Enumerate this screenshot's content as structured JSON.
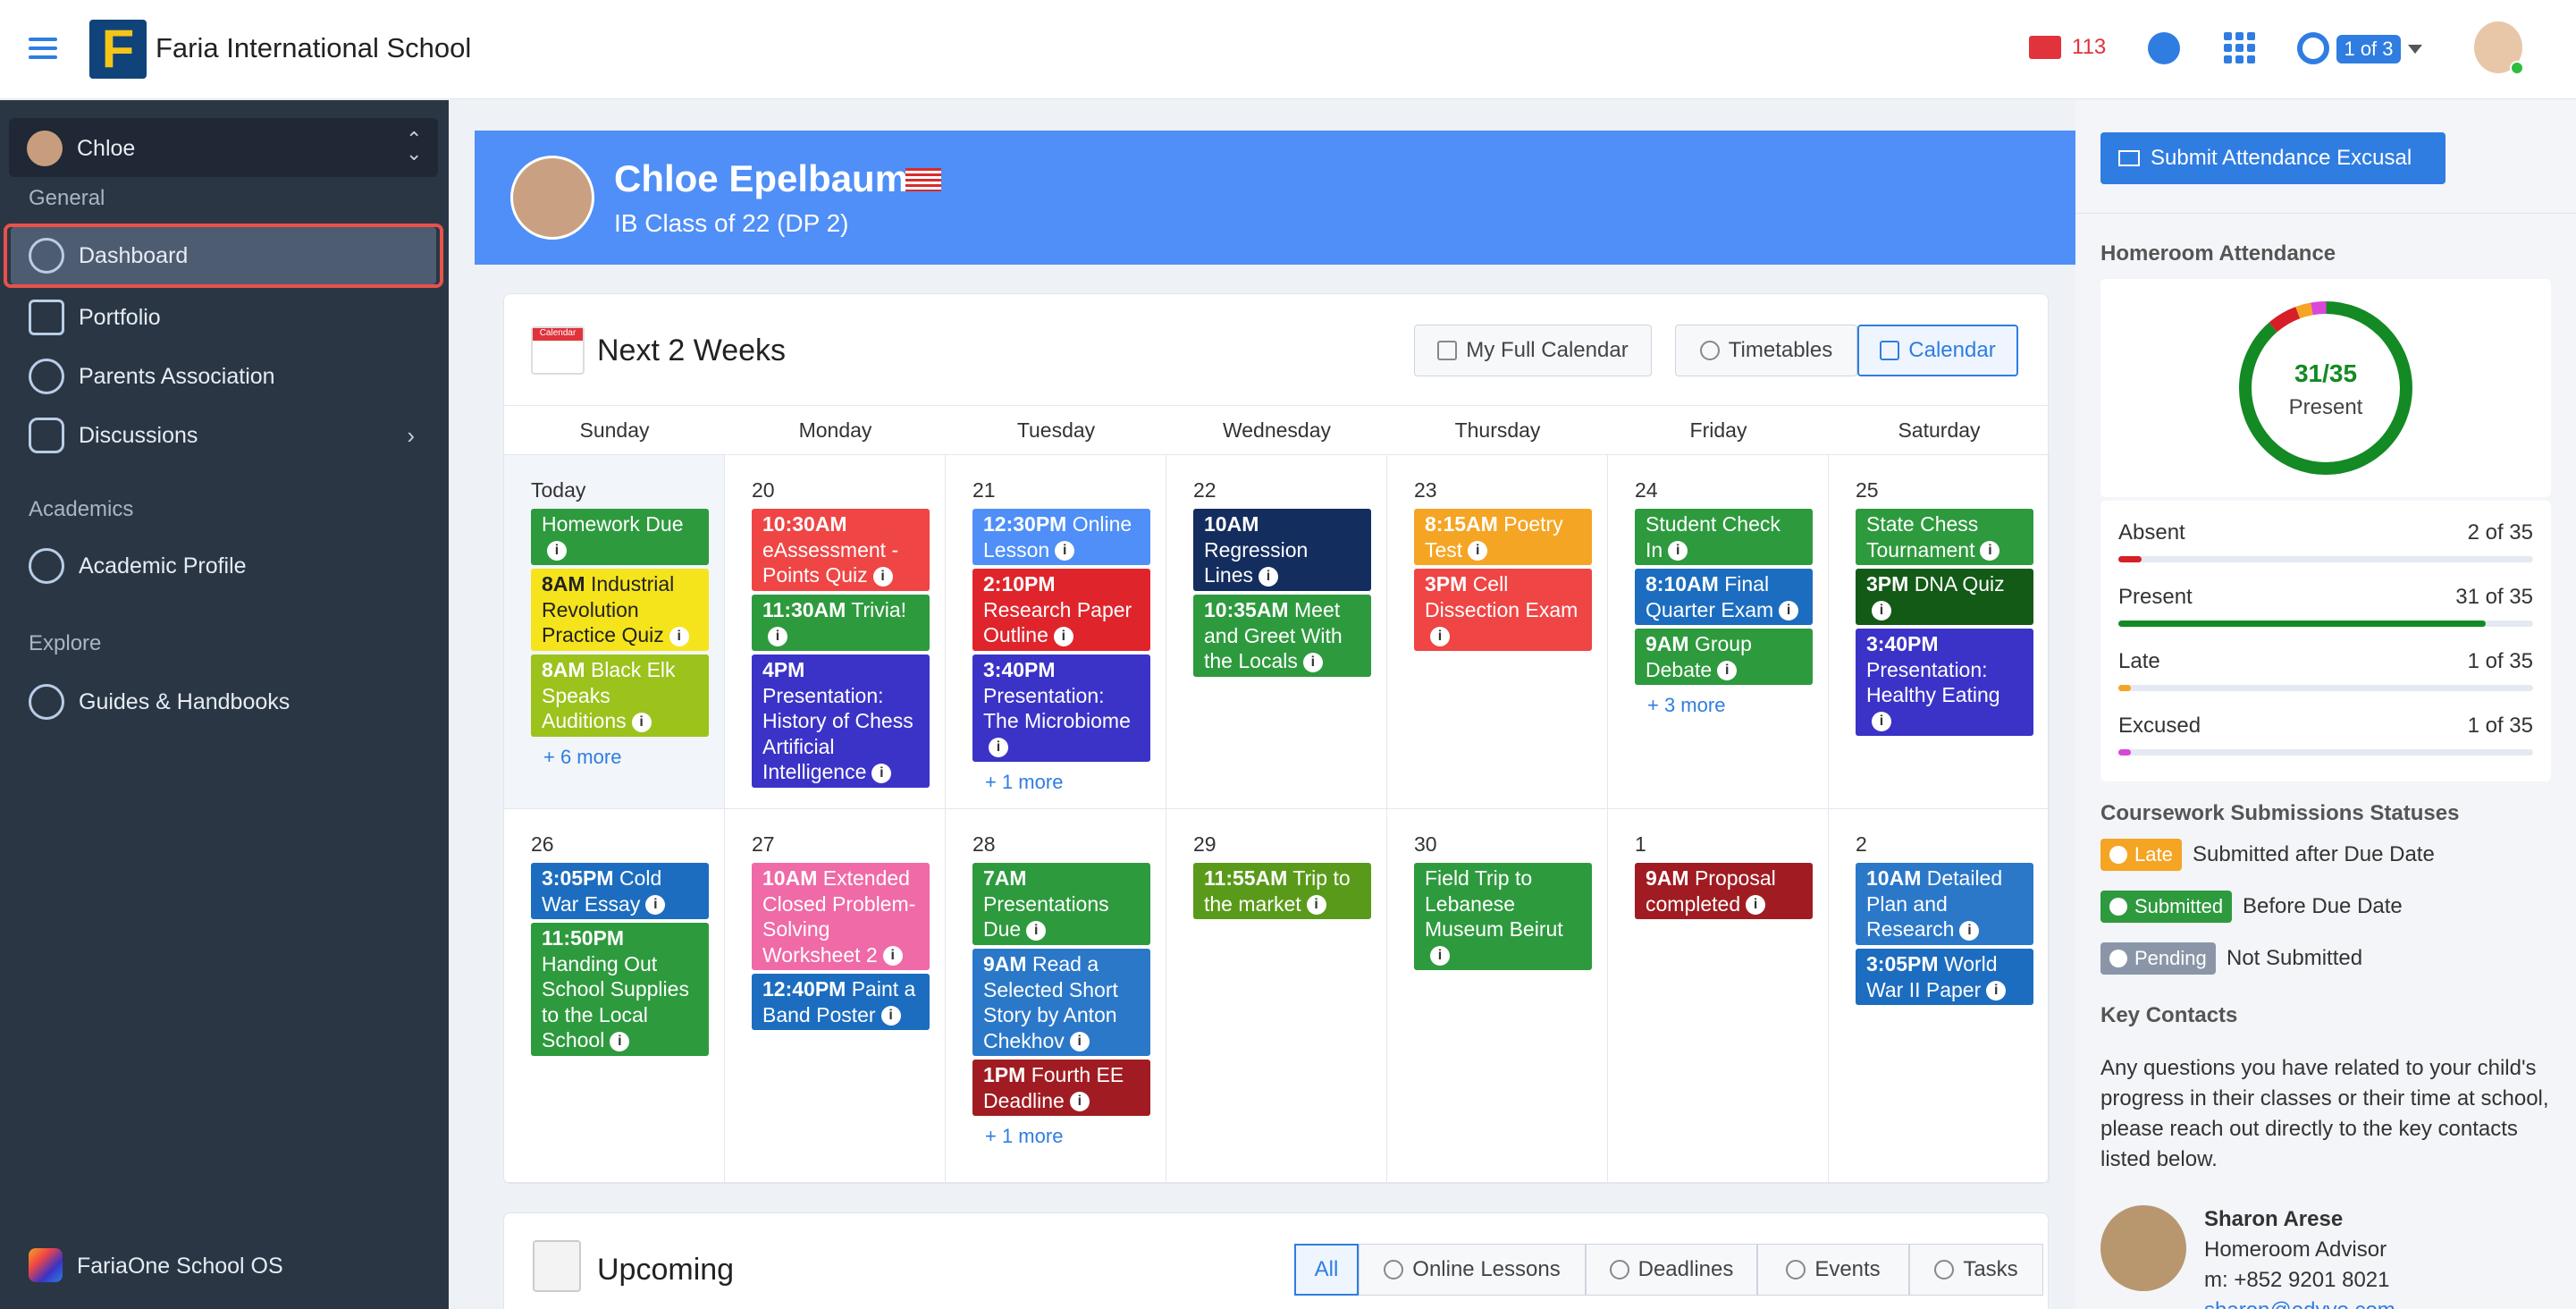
{
  "topbar": {
    "school_name": "Faria International School",
    "logo_letter": "F",
    "mail_count": "113",
    "page_indicator": "1 of 3"
  },
  "sidebar": {
    "profile_name": "Chloe",
    "section_general": "General",
    "items_general": [
      "Dashboard",
      "Portfolio",
      "Parents Association",
      "Discussions"
    ],
    "section_academics": "Academics",
    "items_academics": [
      "Academic Profile"
    ],
    "section_explore": "Explore",
    "items_explore": [
      "Guides & Handbooks"
    ],
    "footer": "FariaOne School OS"
  },
  "student": {
    "name": "Chloe Epelbaum",
    "class": "IB Class of 22 (DP 2)"
  },
  "calendar": {
    "title": "Next 2 Weeks",
    "icon_label": "Calendar",
    "buttons": {
      "full": "My Full Calendar",
      "timetables": "Timetables",
      "calendar": "Calendar"
    },
    "days": [
      "Sunday",
      "Monday",
      "Tuesday",
      "Wednesday",
      "Thursday",
      "Friday",
      "Saturday"
    ],
    "week1": [
      {
        "date": "Today",
        "events": [
          {
            "t": "",
            "d": "Homework Due",
            "c": "#2e9a3e"
          },
          {
            "t": "8AM",
            "d": "Industrial Revolution Practice Quiz",
            "c": "#f5e41b",
            "dark": true
          },
          {
            "t": "8AM",
            "d": "Black Elk Speaks Auditions",
            "c": "#9cc21c"
          }
        ],
        "more": "+ 6 more"
      },
      {
        "date": "20",
        "events": [
          {
            "t": "10:30AM",
            "d": "eAssessment - Points Quiz",
            "c": "#ef4545"
          },
          {
            "t": "11:30AM",
            "d": "Trivia!",
            "c": "#2e9a3e"
          },
          {
            "t": "4PM",
            "d": "Presentation: History of Chess Artificial Intelligence",
            "c": "#3b33c7"
          }
        ],
        "more": ""
      },
      {
        "date": "21",
        "events": [
          {
            "t": "12:30PM",
            "d": "Online Lesson",
            "c": "#4f8ff7"
          },
          {
            "t": "2:10PM",
            "d": "Research Paper Outline",
            "c": "#e0242c"
          },
          {
            "t": "3:40PM",
            "d": "Presentation: The Microbiome",
            "c": "#3b33c7"
          }
        ],
        "more": "+ 1 more"
      },
      {
        "date": "22",
        "events": [
          {
            "t": "10AM",
            "d": "Regression Lines",
            "c": "#132d5e"
          },
          {
            "t": "10:35AM",
            "d": "Meet and Greet With the Locals",
            "c": "#2e9a3e"
          }
        ],
        "more": ""
      },
      {
        "date": "23",
        "events": [
          {
            "t": "8:15AM",
            "d": "Poetry Test",
            "c": "#f5a524"
          },
          {
            "t": "3PM",
            "d": "Cell Dissection Exam",
            "c": "#ef4545"
          }
        ],
        "more": ""
      },
      {
        "date": "24",
        "events": [
          {
            "t": "",
            "d": "Student Check In",
            "c": "#2e9a3e"
          },
          {
            "t": "8:10AM",
            "d": "Final Quarter Exam",
            "c": "#1c6dbf"
          },
          {
            "t": "9AM",
            "d": "Group Debate",
            "c": "#2e9a3e"
          }
        ],
        "more": "+ 3 more"
      },
      {
        "date": "25",
        "events": [
          {
            "t": "",
            "d": "State Chess Tournament",
            "c": "#2e9a3e"
          },
          {
            "t": "3PM",
            "d": "DNA Quiz",
            "c": "#145a17"
          },
          {
            "t": "3:40PM",
            "d": "Presentation: Healthy Eating",
            "c": "#3b33c7"
          }
        ],
        "more": ""
      }
    ],
    "week2": [
      {
        "date": "26",
        "events": [
          {
            "t": "3:05PM",
            "d": "Cold War Essay",
            "c": "#1c6dbf"
          },
          {
            "t": "11:50PM",
            "d": "Handing Out School Supplies to the Local School",
            "c": "#2e9a3e"
          }
        ],
        "more": ""
      },
      {
        "date": "27",
        "events": [
          {
            "t": "10AM",
            "d": "Extended Closed Problem-Solving Worksheet 2",
            "c": "#ef6aa6"
          },
          {
            "t": "12:40PM",
            "d": "Paint a Band Poster",
            "c": "#1c6dbf"
          }
        ],
        "more": ""
      },
      {
        "date": "28",
        "events": [
          {
            "t": "7AM",
            "d": "Presentations Due",
            "c": "#2e9a3e"
          },
          {
            "t": "9AM",
            "d": "Read a Selected Short Story by Anton Chekhov",
            "c": "#2b78c9"
          },
          {
            "t": "1PM",
            "d": "Fourth EE Deadline",
            "c": "#a01c22"
          }
        ],
        "more": "+ 1 more"
      },
      {
        "date": "29",
        "events": [
          {
            "t": "11:55AM",
            "d": "Trip to the market",
            "c": "#5a9a1a"
          }
        ],
        "more": ""
      },
      {
        "date": "30",
        "events": [
          {
            "t": "",
            "d": "Field Trip to Lebanese Museum Beirut",
            "c": "#2e9a3e"
          }
        ],
        "more": ""
      },
      {
        "date": "1",
        "events": [
          {
            "t": "9AM",
            "d": "Proposal completed",
            "c": "#a01c22"
          }
        ],
        "more": ""
      },
      {
        "date": "2",
        "events": [
          {
            "t": "10AM",
            "d": "Detailed Plan and Research",
            "c": "#2b78c9"
          },
          {
            "t": "3:05PM",
            "d": "World War II Paper",
            "c": "#1c6dbf"
          }
        ],
        "more": ""
      }
    ]
  },
  "upcoming": {
    "title": "Upcoming",
    "tabs": [
      "All",
      "Online Lessons",
      "Deadlines",
      "Events",
      "Tasks"
    ]
  },
  "right": {
    "submit_button": "Submit Attendance Excusal",
    "attendance_title": "Homeroom Attendance",
    "donut_value": "31/35",
    "donut_label": "Present",
    "donut_fraction": 0.886,
    "stats": [
      {
        "label": "Absent",
        "value": "2 of 35",
        "fraction": 0.057,
        "color": "#d61f26"
      },
      {
        "label": "Present",
        "value": "31 of 35",
        "fraction": 0.886,
        "color": "#138a23"
      },
      {
        "label": "Late",
        "value": "1 of 35",
        "fraction": 0.029,
        "color": "#f5a524"
      },
      {
        "label": "Excused",
        "value": "1 of 35",
        "fraction": 0.029,
        "color": "#d947d9"
      }
    ],
    "coursework_title": "Coursework Submissions Statuses",
    "statuses": [
      {
        "badge": "Late",
        "text": "Submitted after Due Date",
        "color": "#f5a524"
      },
      {
        "badge": "Submitted",
        "text": "Before Due Date",
        "color": "#2e9a3e"
      },
      {
        "badge": "Pending",
        "text": "Not Submitted",
        "color": "#8a96a8"
      }
    ],
    "contacts_title": "Key Contacts",
    "contacts_text": "Any questions you have related to your child's progress in their classes or their time at school, please reach out directly to the key contacts listed below.",
    "contact": {
      "name": "Sharon Arese",
      "role": "Homeroom Advisor",
      "phone": "m: +852 9201 8021",
      "email": "sharon@edyyo.com"
    }
  }
}
